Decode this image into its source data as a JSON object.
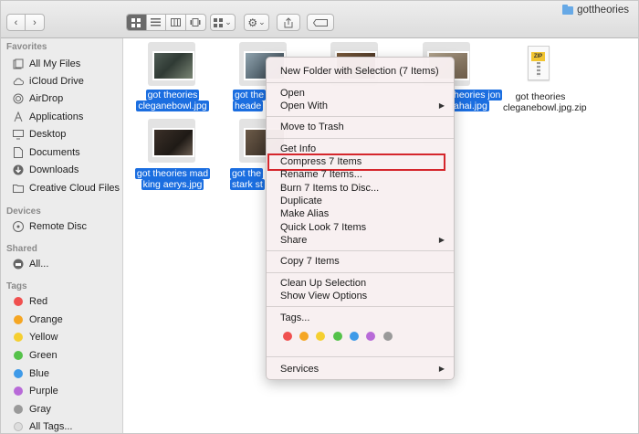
{
  "window": {
    "title": "gottheories"
  },
  "toolbar": {
    "back_icon": "chevron-left-icon",
    "forward_icon": "chevron-right-icon",
    "view_buttons": [
      "icon-view",
      "list-view",
      "column-view",
      "cover-flow-view"
    ],
    "arrange_caret": "⌄",
    "action_caret": "⌄"
  },
  "sidebar": {
    "favorites_header": "Favorites",
    "favorites": [
      {
        "label": "All My Files",
        "icon": "files-icon"
      },
      {
        "label": "iCloud Drive",
        "icon": "cloud-icon"
      },
      {
        "label": "AirDrop",
        "icon": "airdrop-icon"
      },
      {
        "label": "Applications",
        "icon": "applications-icon"
      },
      {
        "label": "Desktop",
        "icon": "desktop-icon"
      },
      {
        "label": "Documents",
        "icon": "documents-icon"
      },
      {
        "label": "Downloads",
        "icon": "downloads-icon"
      },
      {
        "label": "Creative Cloud Files",
        "icon": "folder-icon"
      }
    ],
    "devices_header": "Devices",
    "devices": [
      {
        "label": "Remote Disc",
        "icon": "disc-icon"
      }
    ],
    "shared_header": "Shared",
    "shared": [
      {
        "label": "All...",
        "icon": "network-icon"
      }
    ],
    "tags_header": "Tags",
    "tags": [
      {
        "label": "Red",
        "color": "#f0504f"
      },
      {
        "label": "Orange",
        "color": "#f5a623"
      },
      {
        "label": "Yellow",
        "color": "#f5cf30"
      },
      {
        "label": "Green",
        "color": "#55c24a"
      },
      {
        "label": "Blue",
        "color": "#3e9ae8"
      },
      {
        "label": "Purple",
        "color": "#b86ad8"
      },
      {
        "label": "Gray",
        "color": "#9a9a9a"
      },
      {
        "label": "All Tags...",
        "color": "#dddddd"
      }
    ]
  },
  "files": [
    {
      "name_line1": "got theories",
      "name_line2": "cleganebowl.jpg",
      "selected": true
    },
    {
      "name_line1": "got the",
      "name_line2": "heade",
      "selected": true
    },
    {
      "name_line1": "",
      "name_line2": "",
      "selected": true
    },
    {
      "name_line1": "heories jon",
      "name_line2": "ahai.jpg",
      "selected": true
    },
    {
      "name_line1": "got theories",
      "name_line2": "cleganebowl.jpg.zip",
      "selected": false,
      "badge": "ZIP"
    },
    {
      "name_line1": "got theories mad",
      "name_line2": "king aerys.jpg",
      "selected": true
    },
    {
      "name_line1": "got the",
      "name_line2": "stark st",
      "selected": true
    }
  ],
  "context_menu": {
    "items": [
      {
        "label": "New Folder with Selection (7 Items)"
      },
      {
        "label": "Open"
      },
      {
        "label": "Open With",
        "submenu": true
      },
      {
        "label": "Move to Trash"
      },
      {
        "label": "Get Info"
      },
      {
        "label": "Compress 7 Items",
        "highlighted": true
      },
      {
        "label": "Rename 7 Items..."
      },
      {
        "label": "Burn 7 Items to Disc..."
      },
      {
        "label": "Duplicate"
      },
      {
        "label": "Make Alias"
      },
      {
        "label": "Quick Look 7 Items"
      },
      {
        "label": "Share",
        "submenu": true
      },
      {
        "label": "Copy 7 Items"
      },
      {
        "label": "Clean Up Selection"
      },
      {
        "label": "Show View Options"
      },
      {
        "label": "Tags..."
      },
      {
        "label": "Services",
        "submenu": true
      }
    ],
    "submenu_arrow": "▶",
    "tag_colors": [
      "#f0504f",
      "#f5a623",
      "#f5cf30",
      "#55c24a",
      "#3e9ae8",
      "#b86ad8",
      "#9a9a9a"
    ],
    "highlight_color": "#d5262c"
  }
}
